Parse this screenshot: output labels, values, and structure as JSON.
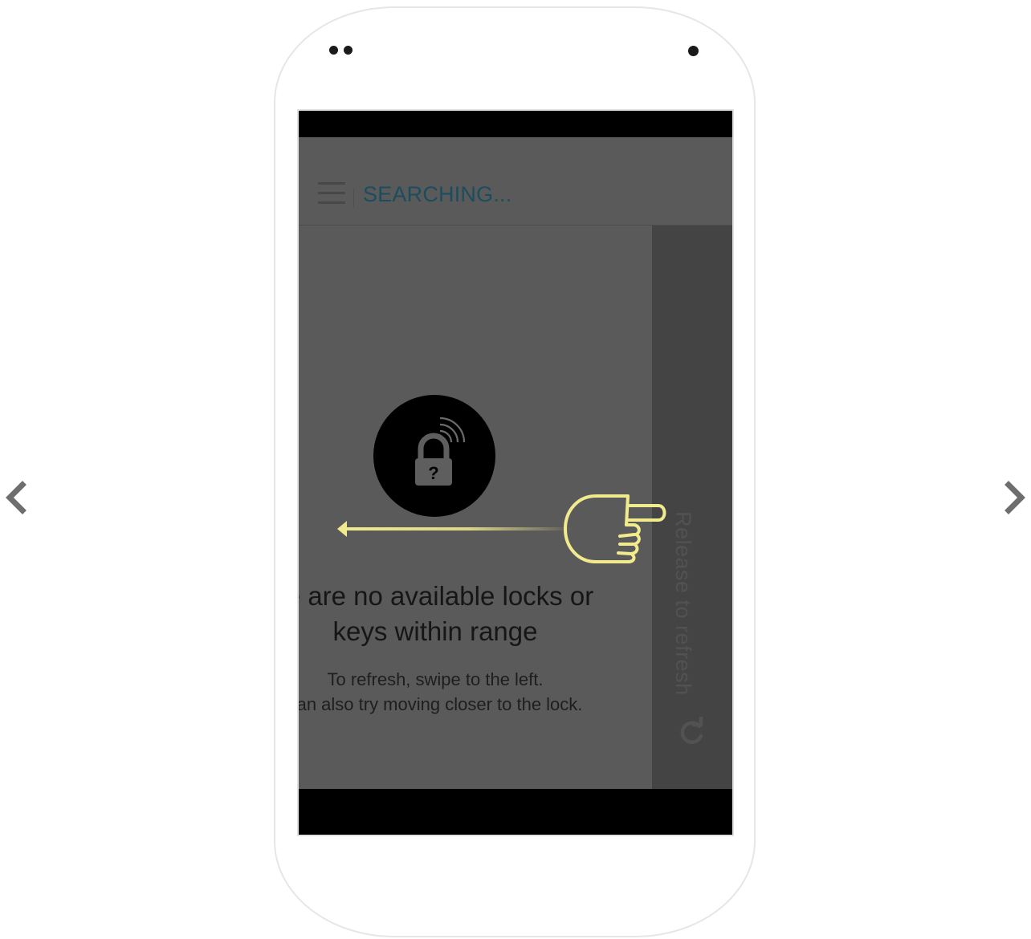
{
  "carousel": {
    "prev_icon": "chevron-left-icon",
    "next_icon": "chevron-right-icon",
    "arrow_color": "#6e6e6e"
  },
  "app_bar": {
    "menu_icon": "hamburger-menu-icon",
    "title": "SEARCHING...",
    "title_color": "#1c4d5e"
  },
  "empty_state": {
    "icon": "lock-question-wireless-icon",
    "title": "re are no available locks or keys within range",
    "body_line1": "To refresh, swipe to the left.",
    "body_line2": "can also try moving closer to the lock."
  },
  "pull_to_refresh": {
    "label": "Release to refresh",
    "icon": "refresh-icon"
  },
  "overlay_hint": {
    "icon": "pointing-hand-icon",
    "arrow_icon": "arrow-left-icon",
    "color": "#f2eb8e"
  }
}
